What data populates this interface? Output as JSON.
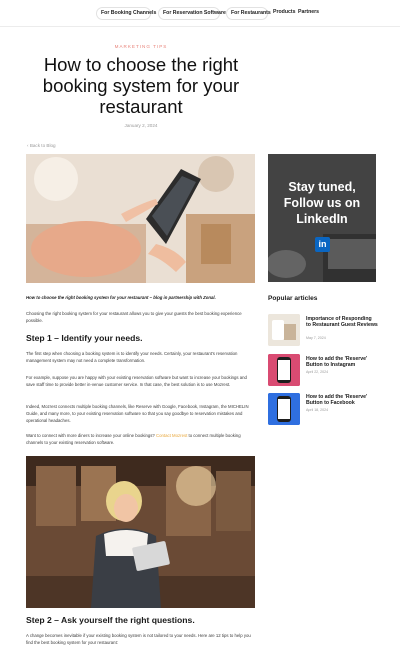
{
  "nav": {
    "pills": [
      "For Booking Channels",
      "For Reservation Software",
      "For Restaurants"
    ],
    "links": [
      "Products",
      "Partners"
    ]
  },
  "article": {
    "category": "MARKETING TIPS",
    "title": "How to choose the right booking system for your restaurant",
    "date": "January 2, 2024",
    "back": "Back to Blog",
    "caption": "How to choose the right booking system for your restaurant – blog in partnership with Zonal.",
    "intro": "Choosing the right booking system for your restaurant allows you to give your guests the best booking experience possible.",
    "step1_heading": "Step 1 – Identify your needs.",
    "p1": "The first step when choosing a booking system is to identify your needs. Certainly, your restaurant's reservation management system may not need a complete transformation.",
    "p2": "For example, suppose you are happy with your existing reservation software but want to increase your bookings and save staff time to provide better in-venue customer service. In that case, the best solution is to use Mozrest.",
    "p3": "Indeed, Mozrest connects multiple booking channels, like Reserve with Google, Facebook, Instagram, the MICHELIN Guide, and many more, to your existing reservation software so that you say goodbye to reservation mistakes and operational headaches.",
    "p4_before": "Want to connect with more diners to increase your online bookings? ",
    "p4_link": "Contact Mozrest",
    "p4_after": " to connect multiple booking channels to your existing reservation software.",
    "step2_heading": "Step 2 – Ask yourself the right questions.",
    "p5": "A change becomes inevitable if your existing booking system is not tailored to your needs. Here are 12 tips to help you find the best booking system for your restaurant:"
  },
  "sidebar": {
    "ad_text": "Stay tuned, Follow us on LinkedIn",
    "linkedin_badge": "in",
    "popular_title": "Popular articles",
    "posts": [
      {
        "title": "Importance of Responding to Restaurant Guest Reviews",
        "date": "May 7, 2024"
      },
      {
        "title": "How to add the 'Reserve' Button to Instagram",
        "date": "April 22, 2024"
      },
      {
        "title": "How to add the 'Reserve' Button to Facebook",
        "date": "April 18, 2024"
      }
    ]
  },
  "colors": {
    "accent": "#e8837a",
    "link": "#e8a63a",
    "linkedin": "#0a66c2"
  }
}
